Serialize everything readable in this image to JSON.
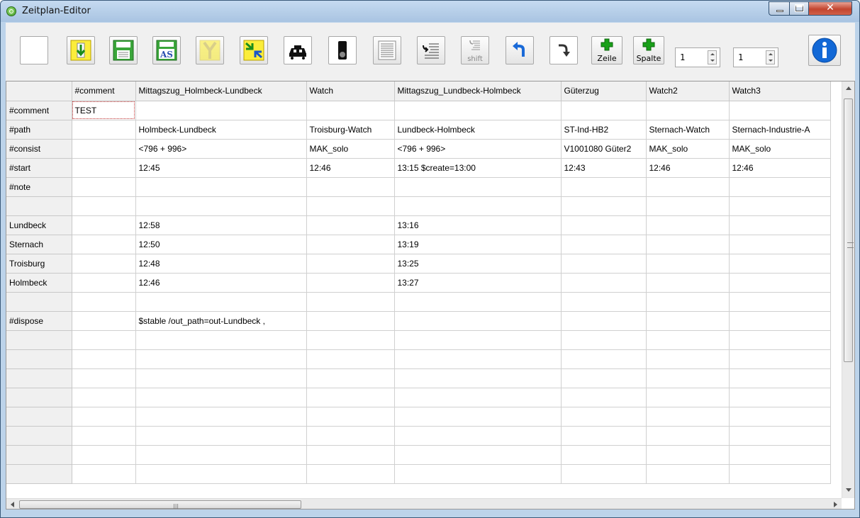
{
  "window": {
    "title": "Zeitplan-Editor"
  },
  "toolbar": {
    "shift_label": "shift",
    "add_row_label": "Zeile",
    "add_col_label": "Spalte",
    "row_spin_value": "1",
    "col_spin_value": "1"
  },
  "grid": {
    "columns": [
      "",
      "#comment",
      "Mittagszug_Holmbeck-Lundbeck",
      "Watch",
      "Mittagszug_Lundbeck-Holmbeck",
      "Güterzug",
      "Watch2",
      "Watch3"
    ],
    "rows": [
      [
        "#comment",
        "TEST",
        "",
        "",
        "",
        "",
        "",
        ""
      ],
      [
        "#path",
        "",
        "Holmbeck-Lundbeck",
        "Troisburg-Watch",
        "Lundbeck-Holmbeck",
        "ST-Ind-HB2",
        "Sternach-Watch",
        "Sternach-Industrie-A"
      ],
      [
        "#consist",
        "",
        "<796 + 996>",
        "MAK_solo",
        "<796 + 996>",
        "V1001080 Güter2",
        "MAK_solo",
        "MAK_solo"
      ],
      [
        "#start",
        "",
        "12:45",
        "12:46",
        "13:15 $create=13:00",
        "12:43",
        "12:46",
        "12:46"
      ],
      [
        "#note",
        "",
        "",
        "",
        "",
        "",
        "",
        ""
      ],
      [
        "",
        "",
        "",
        "",
        "",
        "",
        "",
        ""
      ],
      [
        "Lundbeck",
        "",
        "12:58",
        "",
        "13:16",
        "",
        "",
        ""
      ],
      [
        "Sternach",
        "",
        "12:50",
        "",
        "13:19",
        "",
        "",
        ""
      ],
      [
        "Troisburg",
        "",
        "12:48",
        "",
        "13:25",
        "",
        "",
        ""
      ],
      [
        "Holmbeck",
        "",
        "12:46",
        "",
        "13:27",
        "",
        "",
        ""
      ],
      [
        "",
        "",
        "",
        "",
        "",
        "",
        "",
        ""
      ],
      [
        "#dispose",
        "",
        "$stable /out_path=out-Lundbeck ,",
        "",
        "",
        "",
        "",
        ""
      ],
      [
        "",
        "",
        "",
        "",
        "",
        "",
        "",
        ""
      ],
      [
        "",
        "",
        "",
        "",
        "",
        "",
        "",
        ""
      ],
      [
        "",
        "",
        "",
        "",
        "",
        "",
        "",
        ""
      ],
      [
        "",
        "",
        "",
        "",
        "",
        "",
        "",
        ""
      ],
      [
        "",
        "",
        "",
        "",
        "",
        "",
        "",
        ""
      ],
      [
        "",
        "",
        "",
        "",
        "",
        "",
        "",
        ""
      ],
      [
        "",
        "",
        "",
        "",
        "",
        "",
        "",
        ""
      ],
      [
        "",
        "",
        "",
        "",
        "",
        "",
        "",
        ""
      ]
    ]
  },
  "colors": {
    "accent": "#0a64c8",
    "yellow": "#fbed3b",
    "green": "#3aa63a"
  }
}
